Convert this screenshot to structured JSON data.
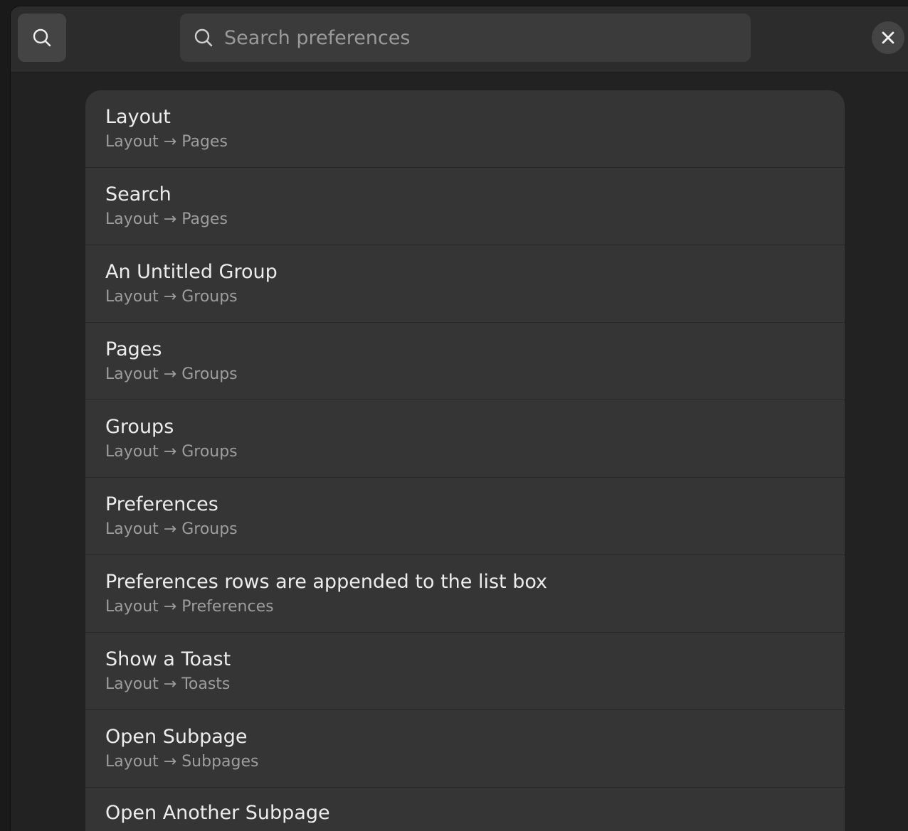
{
  "header": {
    "search_toggle_icon": "search-icon",
    "search": {
      "placeholder": "Search preferences",
      "value": "",
      "icon": "search-icon"
    },
    "close_icon": "close-icon"
  },
  "results": [
    {
      "title": "Layout",
      "path": "Layout → Pages"
    },
    {
      "title": "Search",
      "path": "Layout → Pages"
    },
    {
      "title": "An Untitled Group",
      "path": "Layout → Groups"
    },
    {
      "title": "Pages",
      "path": "Layout → Groups"
    },
    {
      "title": "Groups",
      "path": "Layout → Groups"
    },
    {
      "title": "Preferences",
      "path": "Layout → Groups"
    },
    {
      "title": "Preferences rows are appended to the list box",
      "path": "Layout → Preferences"
    },
    {
      "title": "Show a Toast",
      "path": "Layout → Toasts"
    },
    {
      "title": "Open Subpage",
      "path": "Layout → Subpages"
    },
    {
      "title": "Open Another Subpage",
      "path": ""
    }
  ]
}
